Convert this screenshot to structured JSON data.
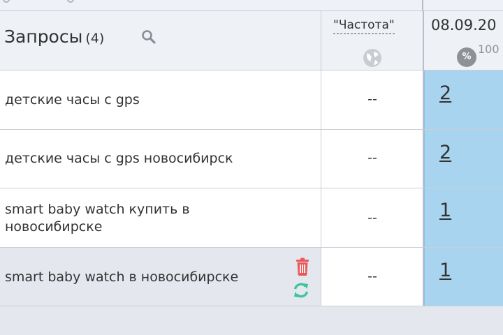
{
  "header": {
    "title": "Запросы",
    "count": "(4)",
    "frequency_label": "\"Частота\"",
    "date_label": "08.09.20",
    "percent_badge": "%",
    "percent_value": "100"
  },
  "rows": [
    {
      "keyword": "детские часы с gps",
      "frequency": "--",
      "position": "2"
    },
    {
      "keyword": "детские часы с gps новосибирск",
      "frequency": "--",
      "position": "2"
    },
    {
      "keyword": "smart baby watch купить в новосибирске",
      "frequency": "--",
      "position": "1"
    },
    {
      "keyword": "smart baby watch в новосибирске",
      "frequency": "--",
      "position": "1"
    }
  ],
  "icons": {
    "search": "search-icon",
    "globe": "globe-icon",
    "trash": "trash-icon",
    "refresh": "refresh-icon"
  },
  "colors": {
    "position_cell": "#a9d4f0",
    "trash": "#e8585a",
    "refresh": "#3cc49a",
    "header_bg": "#eef1f5",
    "hover_row": "#e4e8ee"
  }
}
